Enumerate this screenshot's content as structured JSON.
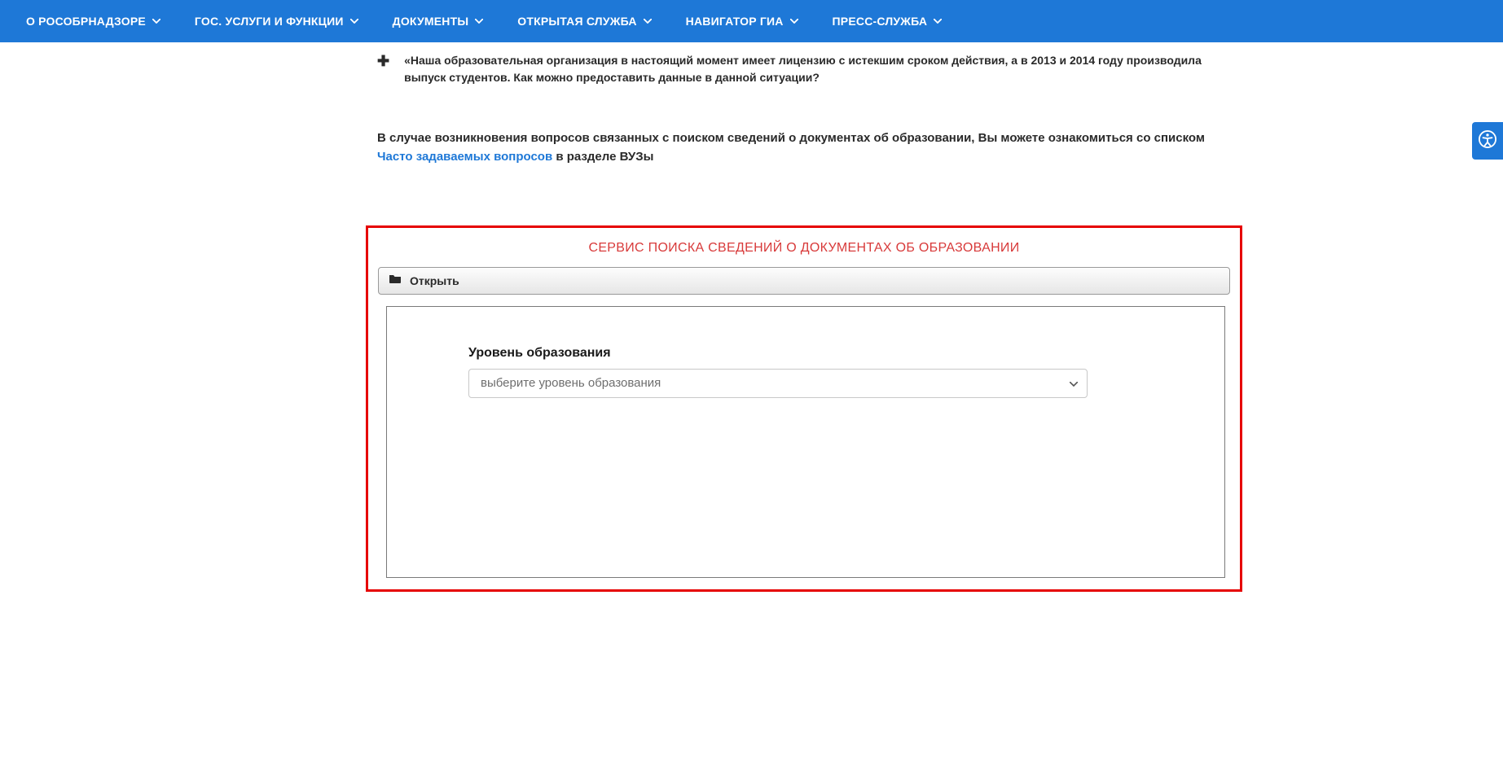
{
  "nav": {
    "items": [
      {
        "label": "О РОСОБРНАДЗОРЕ"
      },
      {
        "label": "ГОС. УСЛУГИ И ФУНКЦИИ"
      },
      {
        "label": "ДОКУМЕНТЫ"
      },
      {
        "label": "ОТКРЫТАЯ СЛУЖБА"
      },
      {
        "label": "НАВИГАТОР ГИА"
      },
      {
        "label": "ПРЕСС-СЛУЖБА"
      }
    ]
  },
  "faq": {
    "item_text": "«Наша образовательная организация в настоящий момент имеет лицензию с истекшим сроком действия, а в 2013 и 2014 году производила выпуск студентов. Как можно предоставить данные в данной ситуации?"
  },
  "intro": {
    "prefix": "В случае возникновения вопросов связанных с поиском сведений о документах об образовании, Вы можете ознакомиться со списком ",
    "link_text": "Часто задаваемых вопросов",
    "suffix": " в разделе ВУЗы"
  },
  "service": {
    "title": "СЕРВИС ПОИСКА СВЕДЕНИЙ О ДОКУМЕНТАХ ОБ ОБРАЗОВАНИИ",
    "open_label": "Открыть",
    "field": {
      "label": "Уровень образования",
      "placeholder": "выберите уровень образования"
    }
  }
}
